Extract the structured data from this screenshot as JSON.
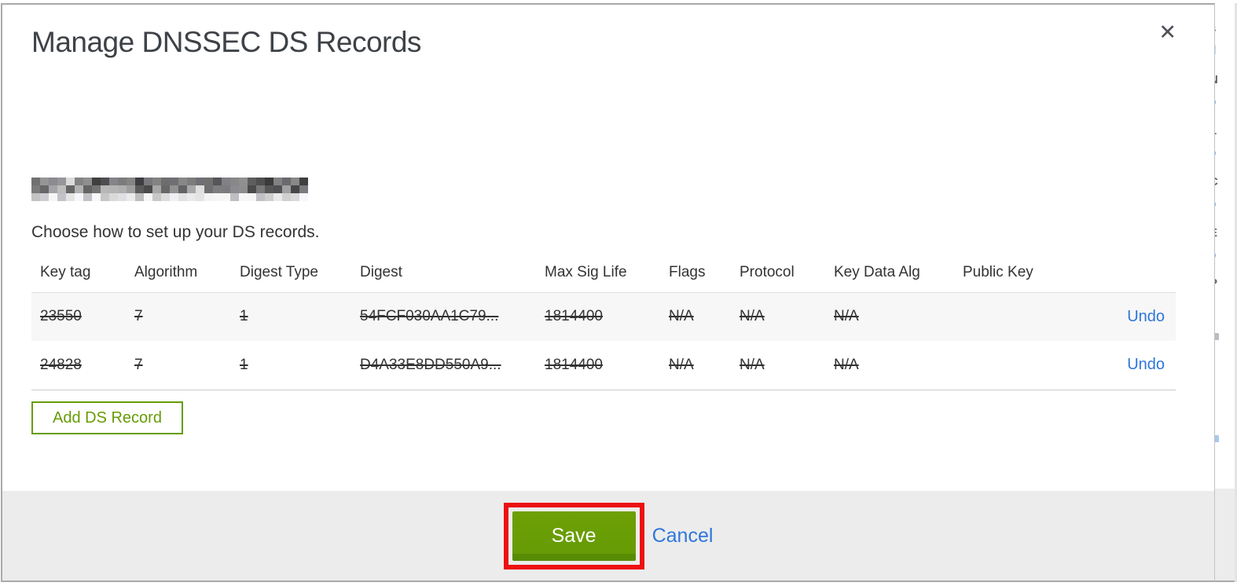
{
  "window": {
    "title": "Manage DNSSEC DS Records",
    "close_icon": "✕"
  },
  "domain": {
    "redacted": true
  },
  "subtitle": "Choose how to set up your DS records.",
  "table": {
    "columns": [
      "Key tag",
      "Algorithm",
      "Digest Type",
      "Digest",
      "Max Sig Life",
      "Flags",
      "Protocol",
      "Key Data Alg",
      "Public Key",
      ""
    ],
    "rows": [
      {
        "key_tag": "23550",
        "algorithm": "7",
        "digest_type": "1",
        "digest": "54FCF030AA1C79...",
        "max_sig_life": "1814400",
        "flags": "N/A",
        "protocol": "N/A",
        "key_data_alg": "N/A",
        "public_key": "",
        "action": "Undo",
        "struck": true
      },
      {
        "key_tag": "24828",
        "algorithm": "7",
        "digest_type": "1",
        "digest": "D4A33E8DD550A9...",
        "max_sig_life": "1814400",
        "flags": "N/A",
        "protocol": "N/A",
        "key_data_alg": "N/A",
        "public_key": "",
        "action": "Undo",
        "struck": true
      }
    ]
  },
  "buttons": {
    "add_ds_record": "Add DS Record",
    "save": "Save",
    "cancel": "Cancel"
  },
  "colors": {
    "accent_green": "#679b05",
    "green_dark": "#588c04",
    "link_blue": "#2e77dc",
    "highlight_red": "#ec1111",
    "footer_bg": "#ececec",
    "row_alt_bg": "#f7f7f7"
  },
  "background_sliver": {
    "fragments_dark": [
      "s",
      "N",
      "L",
      "C",
      "E",
      "P"
    ],
    "fragments_blue": [
      "d",
      "o",
      "o",
      "o",
      "o",
      "J"
    ]
  }
}
